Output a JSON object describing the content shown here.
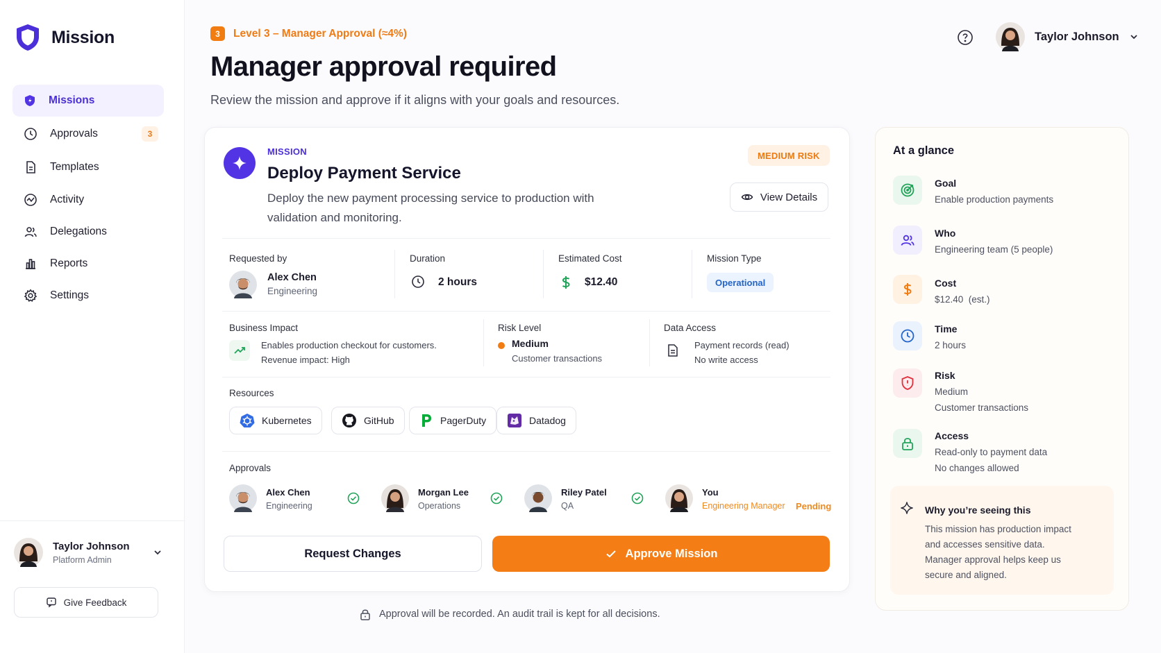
{
  "brand": {
    "name": "Mission",
    "color": "#4b2fd8"
  },
  "sidebar": {
    "items": [
      {
        "label": "Missions",
        "icon": "missions-icon",
        "active": true
      },
      {
        "label": "Approvals",
        "icon": "clock-icon",
        "badge": "3"
      },
      {
        "label": "Templates",
        "icon": "document-icon"
      },
      {
        "label": "Activity",
        "icon": "activity-icon"
      },
      {
        "label": "Delegations",
        "icon": "users-icon"
      },
      {
        "label": "Reports",
        "icon": "bar-chart-icon"
      },
      {
        "label": "Settings",
        "icon": "gear-icon"
      }
    ],
    "user": {
      "name": "Taylor Johnson",
      "role": "Platform Admin"
    },
    "feedback_label": "Give Feedback"
  },
  "header": {
    "level_number": "3",
    "level_text": "Level 3 – Manager Approval (≈4%)",
    "title": "Manager approval required",
    "subtitle": "Review the mission and approve if it aligns with your goals and resources.",
    "user_name": "Taylor Johnson"
  },
  "mission": {
    "label": "MISSION",
    "title": "Deploy Payment Service",
    "description": "Deploy the new payment processing service to production with validation and monitoring.",
    "risk_badge": "MEDIUM RISK",
    "view_details_label": "View Details",
    "requested_by": {
      "label": "Requested by",
      "name": "Alex Chen",
      "team": "Engineering"
    },
    "duration": {
      "label": "Duration",
      "value": "2 hours"
    },
    "cost": {
      "label": "Estimated Cost",
      "value": "$12.40"
    },
    "type": {
      "label": "Mission Type",
      "value": "Operational"
    },
    "business_impact": {
      "label": "Business Impact",
      "line1": "Enables production checkout for customers.",
      "line2": "Revenue impact: High"
    },
    "risk_level": {
      "label": "Risk Level",
      "value": "Medium",
      "detail": "Customer transactions"
    },
    "data_access": {
      "label": "Data Access",
      "line1": "Payment records (read)",
      "line2": "No write access"
    },
    "resources_label": "Resources",
    "resources": [
      "Kubernetes",
      "GitHub",
      "PagerDuty",
      "Datadog"
    ],
    "approvals_label": "Approvals",
    "approvals": [
      {
        "name": "Alex Chen",
        "team": "Engineering",
        "status": "approved"
      },
      {
        "name": "Morgan Lee",
        "team": "Operations",
        "status": "approved"
      },
      {
        "name": "Riley Patel",
        "team": "QA",
        "status": "approved"
      },
      {
        "name": "You",
        "team": "Engineering Manager",
        "status": "Pending"
      }
    ],
    "request_changes_label": "Request Changes",
    "approve_label": "Approve Mission"
  },
  "audit_note": "Approval will be recorded. An audit trail is kept for all decisions.",
  "glance": {
    "title": "At a glance",
    "items": [
      {
        "label": "Goal",
        "value": "Enable production payments",
        "icon": "target-icon"
      },
      {
        "label": "Who",
        "value": "Engineering team (5 people)",
        "icon": "team-icon"
      },
      {
        "label": "Cost",
        "value": "$12.40  (est.)",
        "icon": "dollar-icon"
      },
      {
        "label": "Time",
        "value": "2 hours",
        "icon": "time-icon"
      },
      {
        "label": "Risk",
        "value": "Medium",
        "value2": "Customer transactions",
        "icon": "shield-alert-icon"
      },
      {
        "label": "Access",
        "value": "Read-only to payment data",
        "value2": "No changes allowed",
        "icon": "lock-icon"
      }
    ],
    "why": {
      "title": "Why you’re seeing this",
      "lines": [
        "This mission has production impact",
        "and accesses sensitive data.",
        "Manager approval helps keep us",
        "secure and aligned."
      ]
    }
  },
  "colors": {
    "accent": "#f47e15",
    "primary": "#5234e4",
    "pending": "#ef8a20",
    "success": "#22a35a"
  }
}
